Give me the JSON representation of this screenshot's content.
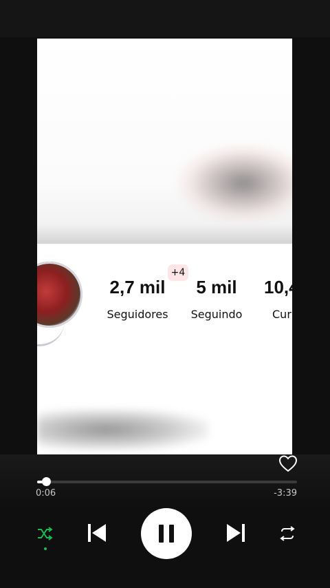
{
  "profile": {
    "badge": "+4",
    "stats": [
      {
        "value": "2,7 mil",
        "label": "Seguidores"
      },
      {
        "value": "5 mil",
        "label": "Seguindo"
      },
      {
        "value": "10,4",
        "label": "Cur"
      }
    ]
  },
  "player": {
    "elapsed": "0:06",
    "remaining": "-3:39",
    "progress_fraction": 0.035,
    "shuffle_active": true,
    "state": "playing"
  },
  "icons": [
    "heart-icon",
    "shuffle-icon",
    "previous-icon",
    "pause-icon",
    "next-icon",
    "repeat-icon"
  ],
  "colors": {
    "accent": "#1db954",
    "background": "#0f0f10",
    "track": "#3b3b3b"
  }
}
